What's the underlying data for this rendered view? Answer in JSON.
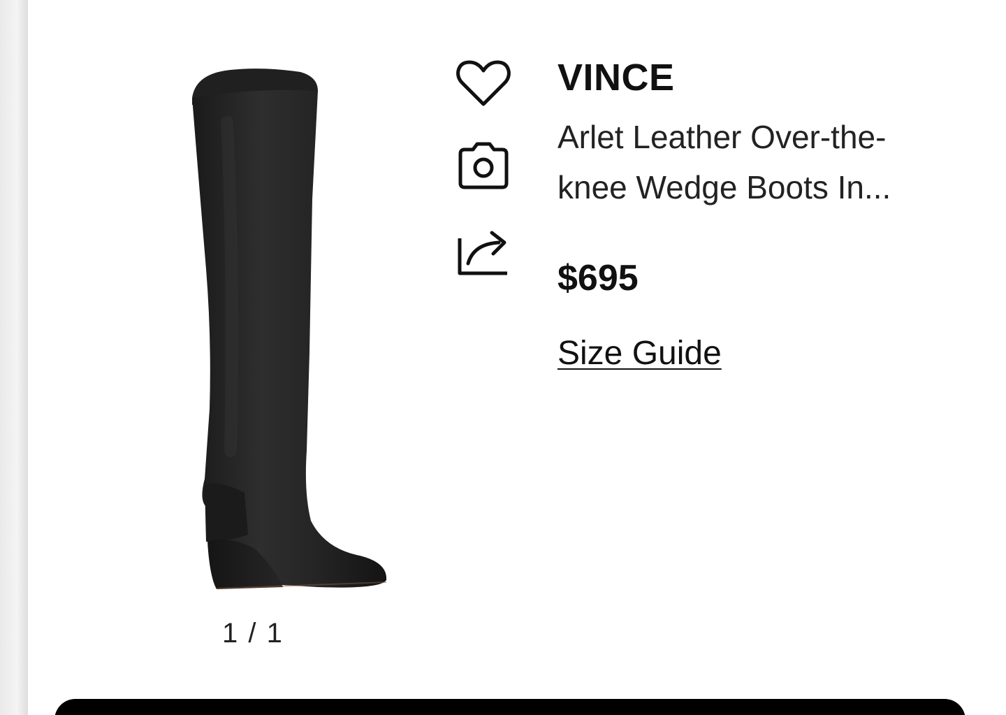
{
  "top_strip": {
    "text": ""
  },
  "product": {
    "brand": "VINCE",
    "name": "Arlet Leather Over-the-knee Wedge Boots In...",
    "name_line1": "Arlet Leather Over-the-",
    "name_line2": "knee Wedge Boots In...",
    "price": "$695",
    "size_guide_label": "Size Guide"
  },
  "gallery": {
    "counter": "1 / 1",
    "image_description_color": "#1c1c1c"
  },
  "actions": {
    "icons": [
      "heart-icon",
      "camera-icon",
      "share-icon"
    ]
  },
  "colors": {
    "text": "#111111",
    "button": "#000000",
    "background": "#ffffff"
  }
}
